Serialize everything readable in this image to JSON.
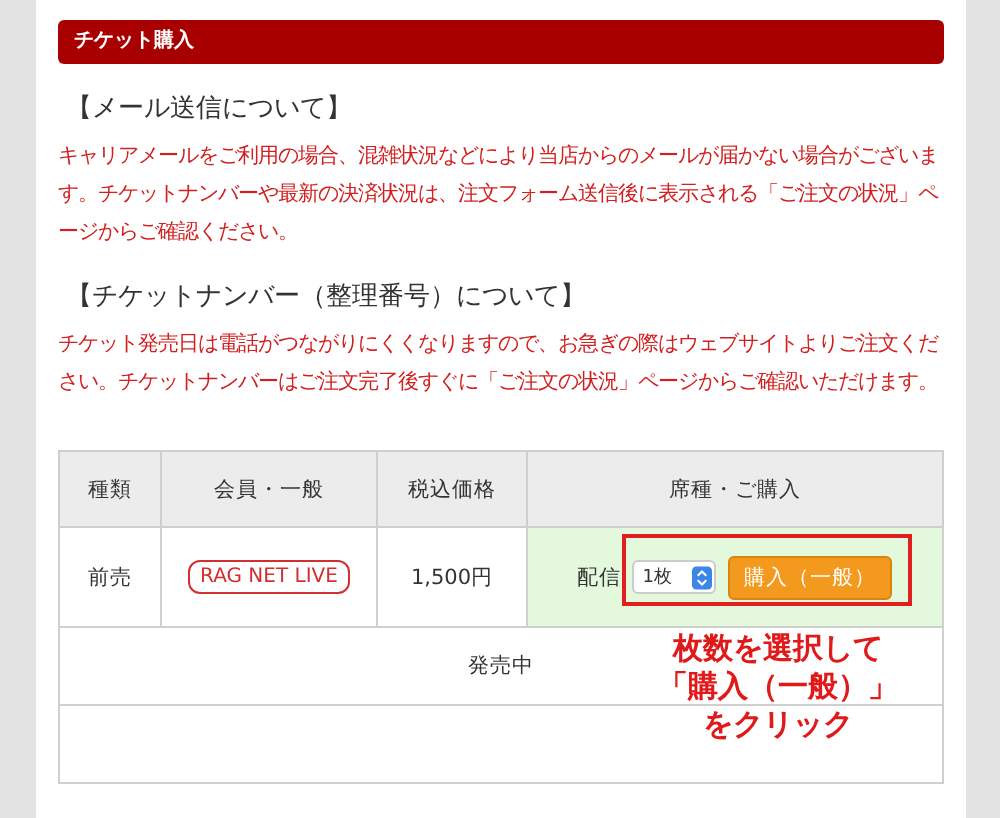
{
  "header": {
    "title": "チケット購入"
  },
  "sections": [
    {
      "heading": "【メール送信について】",
      "body": "キャリアメールをご利用の場合、混雑状況などにより当店からのメールが届かない場合がございます。チケットナンバーや最新の決済状況は、注文フォーム送信後に表示される「ご注文の状況」ページからご確認ください。"
    },
    {
      "heading": "【チケットナンバー（整理番号）について】",
      "body": "チケット発売日は電話がつながりにくくなりますので、お急ぎの際はウェブサイトよりご注文ください。チケットナンバーはご注文完了後すぐに「ご注文の状況」ページからご確認いただけます。"
    }
  ],
  "table": {
    "columns": [
      "種類",
      "会員・一般",
      "税込価格",
      "席種・ご購入"
    ],
    "rows": [
      {
        "type": "前売",
        "badge": "RAG NET LIVE",
        "price": "1,500円",
        "seat": "配信",
        "quantity": "1枚",
        "buy_button": "購入（一般）"
      }
    ],
    "status": "発売中"
  },
  "annotation": {
    "lines": [
      "枚数を選択して",
      "「購入（一般）」",
      "をクリック"
    ]
  }
}
